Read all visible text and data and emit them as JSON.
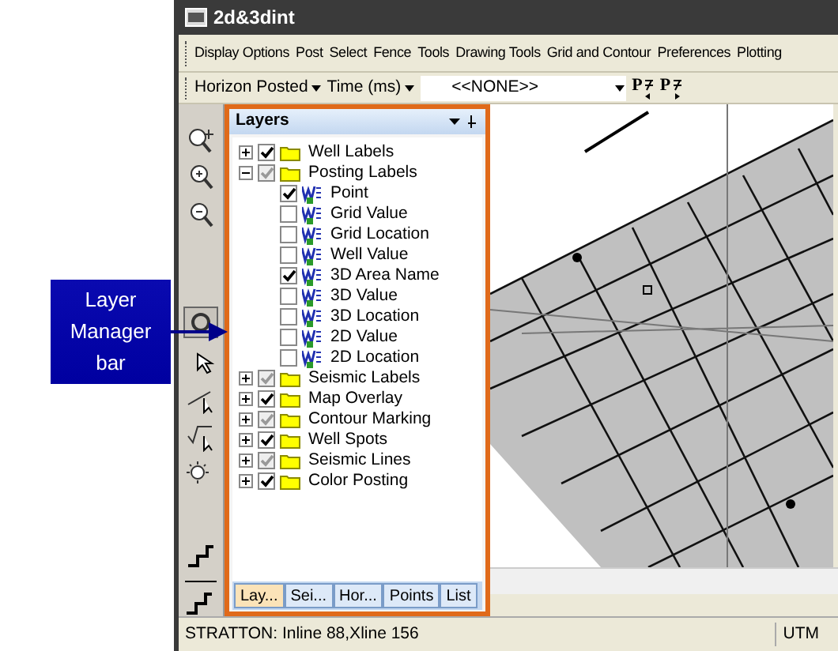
{
  "callout": {
    "text": "Layer Manager bar"
  },
  "window": {
    "title": "2d&3dint"
  },
  "menu": [
    "Display Options",
    "Post",
    "Select",
    "Fence",
    "Tools",
    "Drawing Tools",
    "Grid and Contour",
    "Preferences",
    "Plotting"
  ],
  "toolbar": {
    "horizon": "Horizon Posted",
    "time": "Time (ms)",
    "selection": "<<NONE>>",
    "step_buttons": [
      "P",
      "P"
    ]
  },
  "layers_panel": {
    "title": "Layers",
    "tree": [
      {
        "label": "Well Labels",
        "kind": "folder",
        "checked": true,
        "dimmed": false,
        "expanded": false
      },
      {
        "label": "Posting Labels",
        "kind": "folder",
        "checked": true,
        "dimmed": true,
        "expanded": true,
        "children": [
          {
            "label": "Point",
            "kind": "layer",
            "checked": true,
            "dimmed": false
          },
          {
            "label": "Grid Value",
            "kind": "layer",
            "checked": false,
            "dimmed": false
          },
          {
            "label": "Grid Location",
            "kind": "layer",
            "checked": false,
            "dimmed": false
          },
          {
            "label": "Well Value",
            "kind": "layer",
            "checked": false,
            "dimmed": false
          },
          {
            "label": "3D Area Name",
            "kind": "layer",
            "checked": true,
            "dimmed": false
          },
          {
            "label": "3D Value",
            "kind": "layer",
            "checked": false,
            "dimmed": false
          },
          {
            "label": "3D Location",
            "kind": "layer",
            "checked": false,
            "dimmed": false
          },
          {
            "label": "2D Value",
            "kind": "layer",
            "checked": false,
            "dimmed": false
          },
          {
            "label": "2D Location",
            "kind": "layer",
            "checked": false,
            "dimmed": false
          }
        ]
      },
      {
        "label": "Seismic Labels",
        "kind": "folder",
        "checked": true,
        "dimmed": true,
        "expanded": false
      },
      {
        "label": "Map Overlay",
        "kind": "folder",
        "checked": true,
        "dimmed": false,
        "expanded": false
      },
      {
        "label": "Contour Marking",
        "kind": "folder",
        "checked": true,
        "dimmed": true,
        "expanded": false
      },
      {
        "label": "Well Spots",
        "kind": "folder",
        "checked": true,
        "dimmed": false,
        "expanded": false
      },
      {
        "label": "Seismic Lines",
        "kind": "folder",
        "checked": true,
        "dimmed": true,
        "expanded": false
      },
      {
        "label": "Color Posting",
        "kind": "folder",
        "checked": true,
        "dimmed": false,
        "expanded": false
      }
    ],
    "tabs": [
      {
        "label": "Lay...",
        "selected": true
      },
      {
        "label": "Sei...",
        "selected": false
      },
      {
        "label": "Hor...",
        "selected": false
      },
      {
        "label": "Points",
        "selected": false
      },
      {
        "label": "List",
        "selected": false
      }
    ]
  },
  "status_bar": {
    "location": "STRATTON: Inline 88,Xline 156",
    "units": "UTM"
  }
}
